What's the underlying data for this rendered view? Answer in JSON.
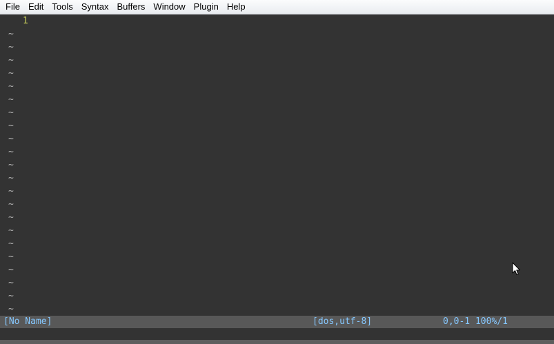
{
  "menubar": {
    "items": [
      {
        "id": "file",
        "label": "File"
      },
      {
        "id": "edit",
        "label": "Edit"
      },
      {
        "id": "tools",
        "label": "Tools"
      },
      {
        "id": "syntax",
        "label": "Syntax"
      },
      {
        "id": "buffers",
        "label": "Buffers"
      },
      {
        "id": "window",
        "label": "Window"
      },
      {
        "id": "plugin",
        "label": "Plugin"
      },
      {
        "id": "help",
        "label": "Help"
      }
    ]
  },
  "editor": {
    "line_number": "1",
    "empty_line_marker": "~",
    "empty_line_count": 22
  },
  "statusline": {
    "filename": "[No Name]",
    "format": "[dos,utf-8]",
    "position": "0,0-1 100%/1"
  },
  "colors": {
    "editor_background": "#333333",
    "line_number": "#c9d05c",
    "tilde": "#b8b8b8",
    "statusline_background": "#585858",
    "statusline_text": "#86c8ff"
  },
  "icons": {
    "pointer": "mouse-pointer-icon"
  }
}
